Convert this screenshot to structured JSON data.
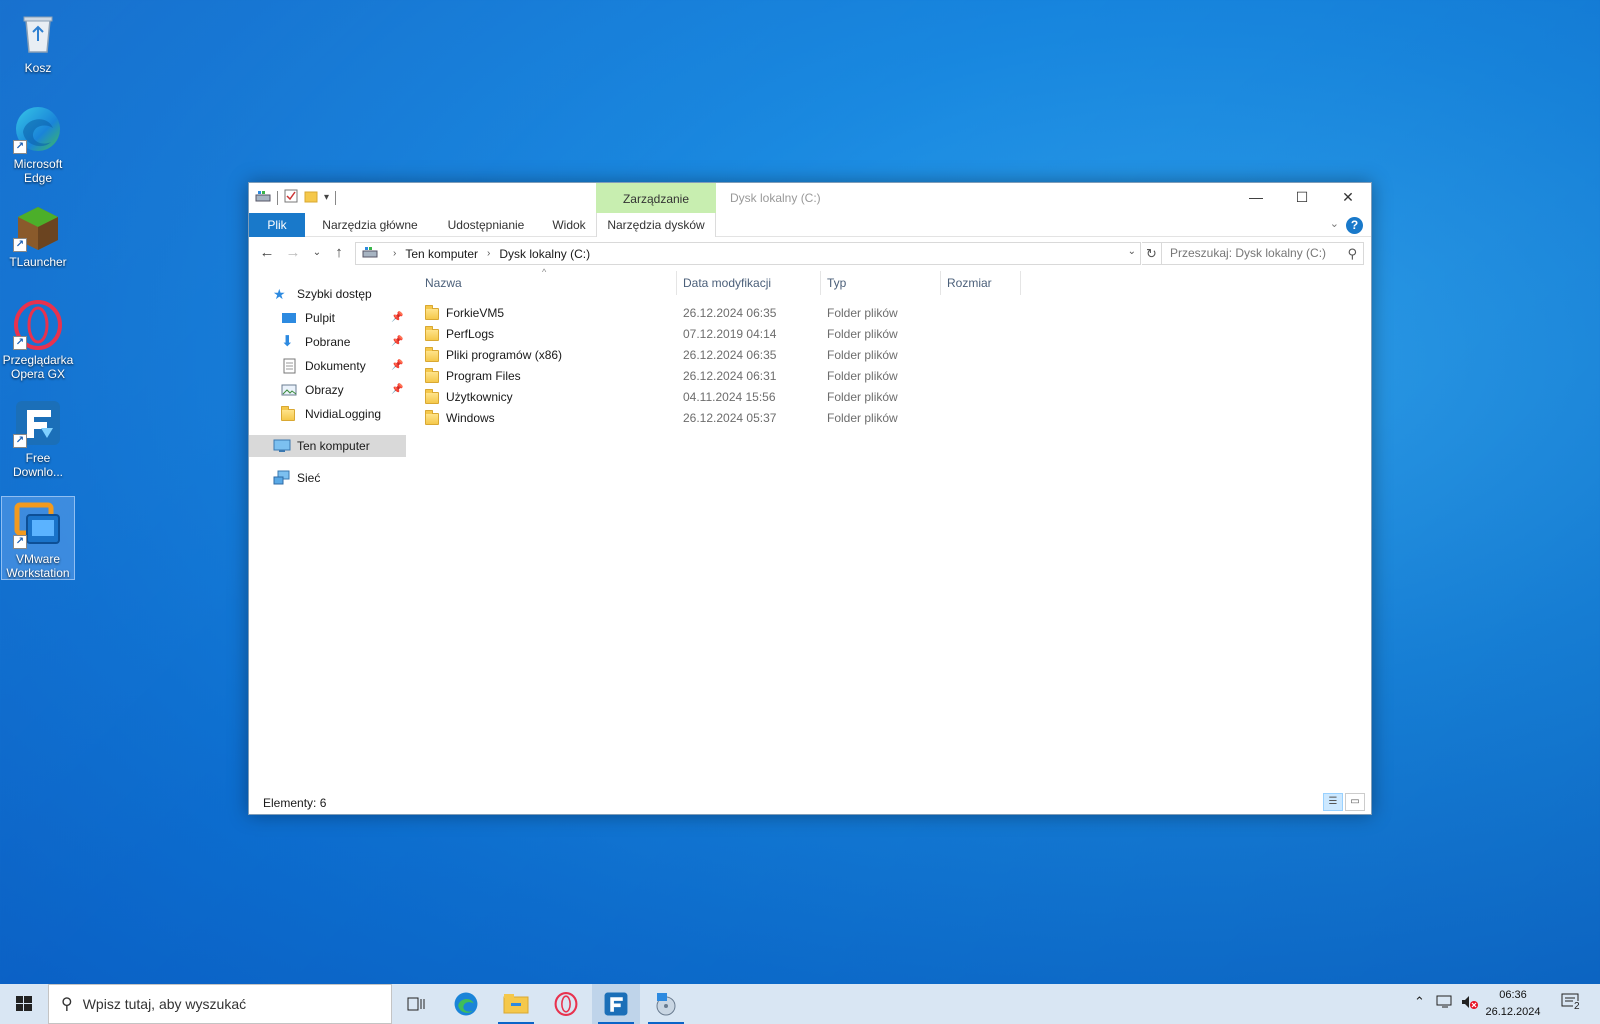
{
  "desktop": {
    "icons": [
      {
        "label": "Kosz"
      },
      {
        "label": "Microsoft Edge"
      },
      {
        "label": "TLauncher"
      },
      {
        "label": "Przeglądarka Opera GX"
      },
      {
        "label": "Free Downlo..."
      },
      {
        "label": "VMware Workstation"
      }
    ]
  },
  "window": {
    "title": "Dysk lokalny (C:)",
    "context_group": "Zarządzanie",
    "tabs": {
      "file": "Plik",
      "home": "Narzędzia główne",
      "share": "Udostępnianie",
      "view": "Widok",
      "drive_tools": "Narzędzia dysków"
    },
    "help": "?",
    "breadcrumb": [
      "Ten komputer",
      "Dysk lokalny (C:)"
    ],
    "search_placeholder": "Przeszukaj: Dysk lokalny (C:)",
    "nav": {
      "quick_access": "Szybki dostęp",
      "desktop": "Pulpit",
      "downloads": "Pobrane",
      "documents": "Dokumenty",
      "pictures": "Obrazy",
      "nvidia": "NvidiaLogging",
      "this_pc": "Ten komputer",
      "network": "Sieć"
    },
    "columns": {
      "name": "Nazwa",
      "date": "Data modyfikacji",
      "type": "Typ",
      "size": "Rozmiar"
    },
    "files": [
      {
        "name": "ForkieVM5",
        "date": "26.12.2024 06:35",
        "type": "Folder plików"
      },
      {
        "name": "PerfLogs",
        "date": "07.12.2019 04:14",
        "type": "Folder plików"
      },
      {
        "name": "Pliki programów (x86)",
        "date": "26.12.2024 06:35",
        "type": "Folder plików"
      },
      {
        "name": "Program Files",
        "date": "26.12.2024 06:31",
        "type": "Folder plików"
      },
      {
        "name": "Użytkownicy",
        "date": "04.11.2024 15:56",
        "type": "Folder plików"
      },
      {
        "name": "Windows",
        "date": "26.12.2024 05:37",
        "type": "Folder plików"
      }
    ],
    "status": "Elementy: 6"
  },
  "taskbar": {
    "search_placeholder": "Wpisz tutaj, aby wyszukać",
    "time": "06:36",
    "date": "26.12.2024",
    "notifications": "2"
  }
}
